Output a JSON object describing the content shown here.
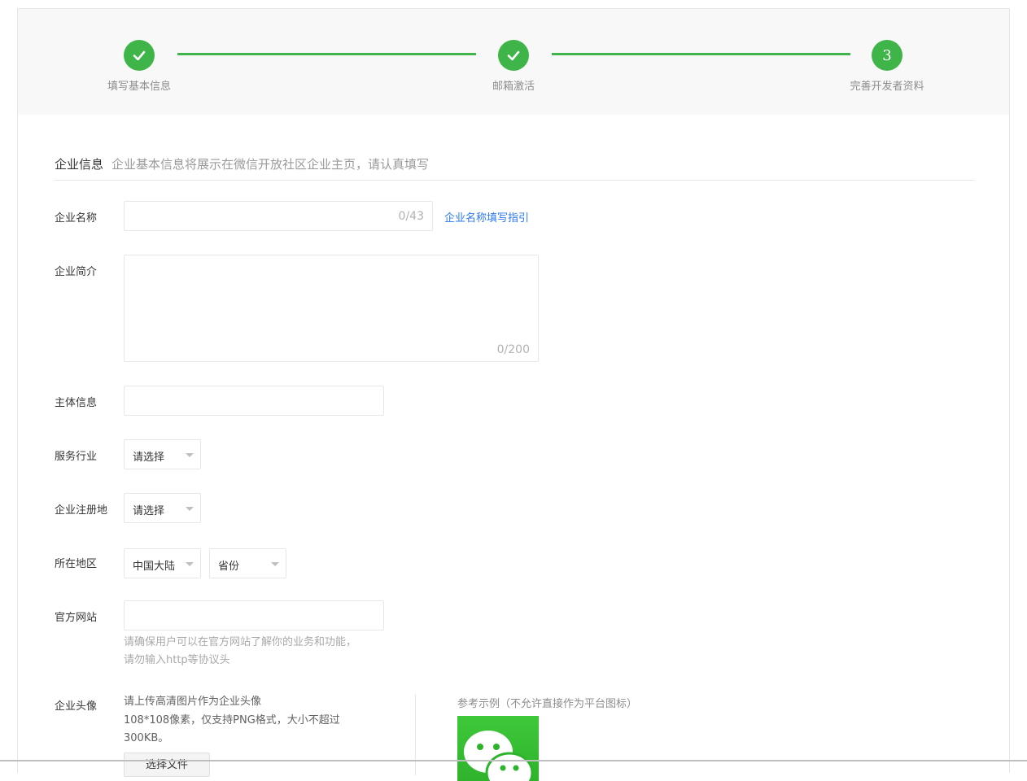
{
  "steps": [
    {
      "label": "填写基本信息",
      "state": "done"
    },
    {
      "label": "邮箱激活",
      "state": "done"
    },
    {
      "label": "完善开发者资料",
      "state": "current",
      "number": "3"
    }
  ],
  "colors": {
    "accent": "#3fb549",
    "link": "#2d78f4"
  },
  "section": {
    "title": "企业信息",
    "desc": "企业基本信息将展示在微信开放社区企业主页，请认真填写"
  },
  "form": {
    "company_name": {
      "label": "企业名称",
      "value": "",
      "counter": "0/43",
      "guide_link": "企业名称填写指引"
    },
    "company_intro": {
      "label": "企业简介",
      "value": "",
      "counter": "0/200"
    },
    "entity_info": {
      "label": "主体信息",
      "value": ""
    },
    "industry": {
      "label": "服务行业",
      "selected": "请选择"
    },
    "reg_place": {
      "label": "企业注册地",
      "selected": "请选择"
    },
    "region": {
      "label": "所在地区",
      "country": "中国大陆",
      "province": "省份"
    },
    "website": {
      "label": "官方网站",
      "value": "",
      "hint_line1": "请确保用户可以在官方网站了解你的业务和功能，",
      "hint_line2": "请勿输入http等协议头"
    },
    "avatar": {
      "label": "企业头像",
      "line1": "请上传高清图片作为企业头像",
      "line2": "108*108像素，仅支持PNG格式，大小不超过",
      "line3": "300KB。",
      "file_button": "选择文件",
      "example_label": "参考示例（不允许直接作为平台图标）",
      "example_icon": "wechat-logo"
    }
  }
}
